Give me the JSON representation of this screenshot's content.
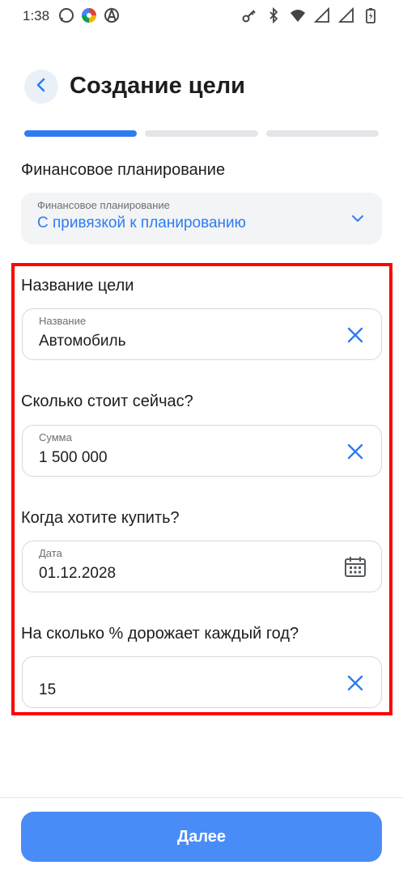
{
  "status_bar": {
    "time": "1:38",
    "left_icons": [
      "whatsapp-icon",
      "photos-icon",
      "anarchy-icon"
    ],
    "right_icons": [
      "key-icon",
      "bluetooth-icon",
      "wifi-icon",
      "signal-icon",
      "signal-icon",
      "battery-charging-icon"
    ]
  },
  "header": {
    "title": "Создание цели"
  },
  "progress": {
    "steps": 3,
    "current_step": 1
  },
  "planning": {
    "section_label": "Финансовое планирование",
    "select_label": "Финансовое планирование",
    "select_value": "С привязкой к планированию"
  },
  "form": {
    "name": {
      "title": "Название цели",
      "label": "Название",
      "value": "Автомобиль"
    },
    "cost": {
      "title": "Сколько стоит сейчас?",
      "label": "Сумма",
      "value": "1 500 000"
    },
    "date": {
      "title": "Когда хотите купить?",
      "label": "Дата",
      "value": "01.12.2028"
    },
    "growth": {
      "title": "На сколько % дорожает каждый год?",
      "value": "15"
    }
  },
  "footer": {
    "next_label": "Далее"
  },
  "colors": {
    "accent": "#2f7cf0",
    "button": "#4a8cf7",
    "highlight": "#ff0000"
  }
}
